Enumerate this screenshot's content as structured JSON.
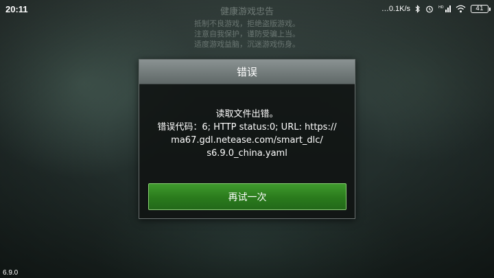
{
  "status_bar": {
    "time": "20:11",
    "net_speed": "0.1K/s",
    "battery_level": "41",
    "icons": [
      "bluetooth-icon",
      "alarm-icon",
      "signal-icon",
      "wifi-icon",
      "battery-icon"
    ]
  },
  "dialog": {
    "title": "错误",
    "message_lines": [
      "读取文件出错。",
      "错误代码：6; HTTP status:0; URL: https://",
      "ma67.gdl.netease.com/smart_dlc/",
      "s6.9.0_china.yaml"
    ],
    "retry_label": "再试一次"
  },
  "version": "6.9.0",
  "colors": {
    "button_green": "#2f8a22",
    "header_gray": "#7a8282",
    "dialog_bg": "#101312"
  }
}
